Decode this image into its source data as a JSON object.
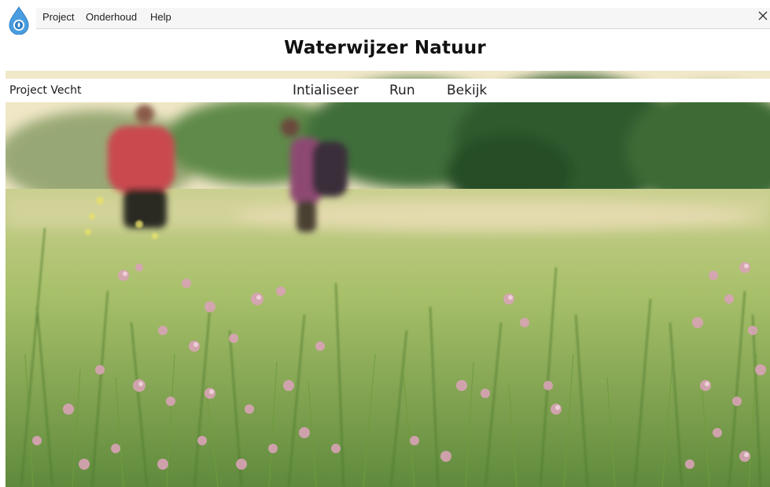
{
  "menubar": {
    "logo_icon": "water-drop-logo-icon",
    "items": [
      {
        "label": "Project"
      },
      {
        "label": "Onderhoud"
      },
      {
        "label": "Help"
      }
    ],
    "close_icon": "close-icon"
  },
  "app": {
    "title": "Waterwijzer Natuur"
  },
  "nav": {
    "project_name": "Project Vecht",
    "links": [
      {
        "label": "Intialiseer"
      },
      {
        "label": "Run"
      },
      {
        "label": "Bekijk"
      }
    ]
  },
  "hero": {
    "image": "meadow-with-pink-flowers-and-two-walkers",
    "colors": {
      "sky": "#efe6c4",
      "trees": "#3f6b3a",
      "grass": "#8fae5a",
      "flowers": "#d8a6b8"
    }
  }
}
